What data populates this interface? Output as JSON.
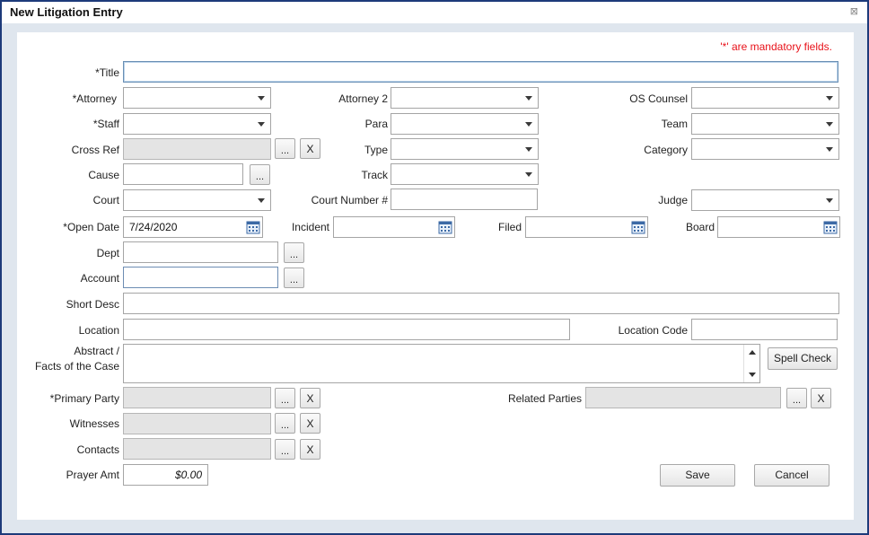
{
  "window": {
    "title": "New Litigation Entry",
    "close_glyph": "⊠"
  },
  "mandatory_note": "'*' are mandatory fields.",
  "fields": {
    "title": {
      "label": "*Title",
      "value": ""
    },
    "attorney": {
      "label": "*Attorney",
      "value": ""
    },
    "attorney2": {
      "label": "Attorney 2",
      "value": ""
    },
    "os_counsel": {
      "label": "OS Counsel",
      "value": ""
    },
    "staff": {
      "label": "*Staff",
      "value": ""
    },
    "para": {
      "label": "Para",
      "value": ""
    },
    "team": {
      "label": "Team",
      "value": ""
    },
    "cross_ref": {
      "label": "Cross Ref",
      "value": ""
    },
    "type": {
      "label": "Type",
      "value": ""
    },
    "category": {
      "label": "Category",
      "value": ""
    },
    "cause": {
      "label": "Cause",
      "value": ""
    },
    "track": {
      "label": "Track",
      "value": ""
    },
    "court": {
      "label": "Court",
      "value": ""
    },
    "court_number": {
      "label": "Court Number #",
      "value": ""
    },
    "judge": {
      "label": "Judge",
      "value": ""
    },
    "open_date": {
      "label": "*Open Date",
      "value": "7/24/2020"
    },
    "incident": {
      "label": "Incident",
      "value": ""
    },
    "filed": {
      "label": "Filed",
      "value": ""
    },
    "board": {
      "label": "Board",
      "value": ""
    },
    "dept": {
      "label": "Dept",
      "value": ""
    },
    "account": {
      "label": "Account",
      "value": ""
    },
    "short_desc": {
      "label": "Short Desc",
      "value": ""
    },
    "location": {
      "label": "Location",
      "value": ""
    },
    "location_code": {
      "label": "Location Code",
      "value": ""
    },
    "abstract": {
      "label_line1": "Abstract /",
      "label_line2": "Facts of the Case",
      "value": ""
    },
    "primary_party": {
      "label": "*Primary Party",
      "value": ""
    },
    "related_parties": {
      "label": "Related Parties",
      "value": ""
    },
    "witnesses": {
      "label": "Witnesses",
      "value": ""
    },
    "contacts": {
      "label": "Contacts",
      "value": ""
    },
    "prayer_amt": {
      "label": "Prayer Amt",
      "value": "$0.00"
    }
  },
  "buttons": {
    "browse": "...",
    "clear": "X",
    "spell_check": "Spell Check",
    "save": "Save",
    "cancel": "Cancel"
  },
  "icons": {
    "dropdown": "chevron-down-icon",
    "calendar": "calendar-icon",
    "scroll_up": "scroll-up-arrow-icon",
    "scroll_down": "scroll-down-arrow-icon",
    "close": "close-icon"
  },
  "colors": {
    "window_border": "#1d3a7a",
    "background": "#dfe6ee",
    "mandatory_text": "#e8121a",
    "focus_border": "#6a8fb4"
  }
}
